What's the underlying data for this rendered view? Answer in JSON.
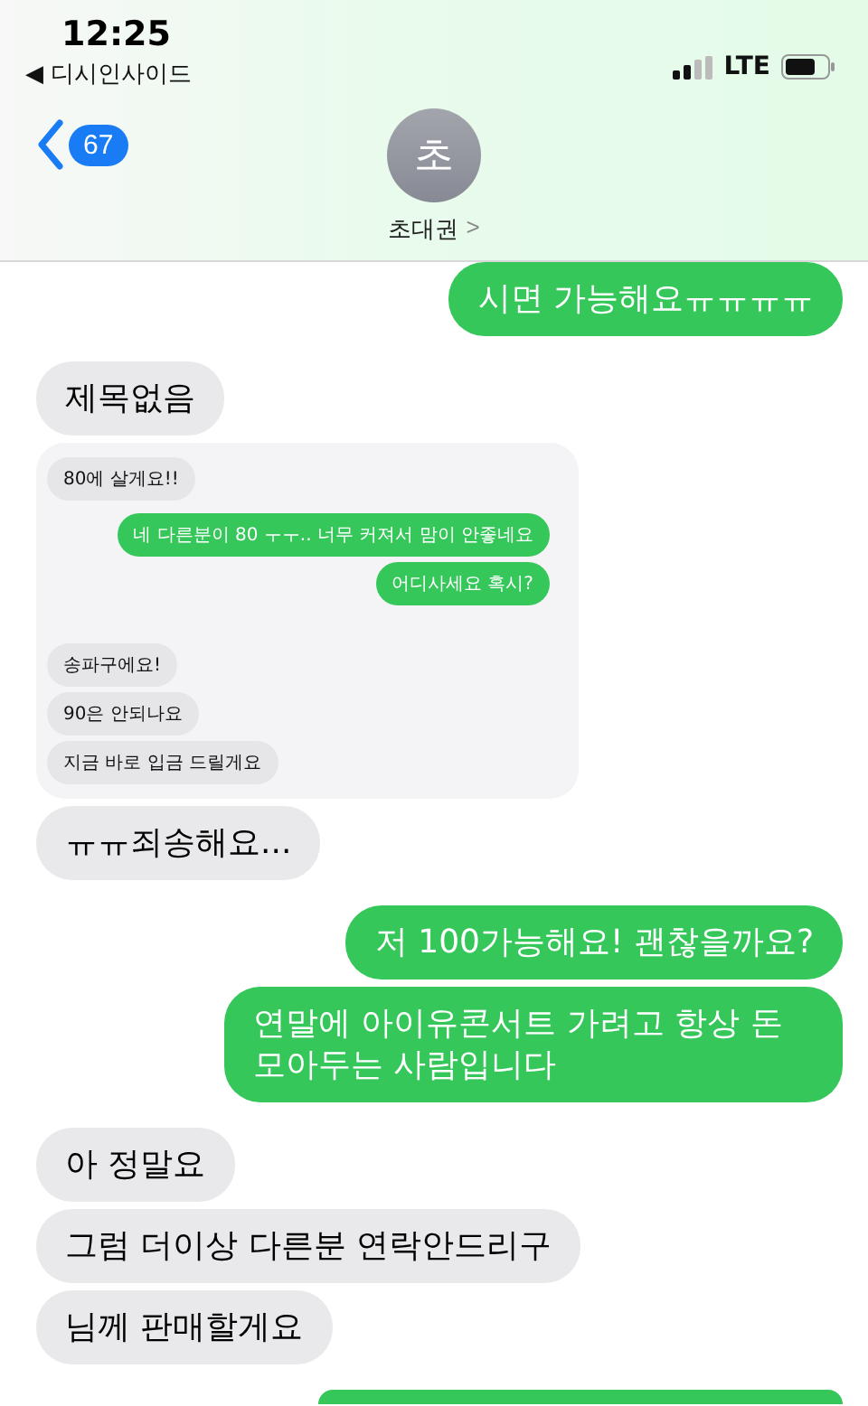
{
  "status_bar": {
    "time": "12:25",
    "back_app": "◀ 디시인사이드",
    "network": "LTE"
  },
  "header": {
    "unread_count": "67",
    "avatar_initial": "초",
    "contact_name": "초대권",
    "name_chevron": ">"
  },
  "messages": [
    {
      "kind": "text",
      "sent": true,
      "text": "시면 가능해요ㅠㅠㅠㅠ"
    },
    {
      "kind": "text",
      "sent": false,
      "text": "제목없음"
    },
    {
      "kind": "screenshot",
      "sent": false,
      "messages": [
        {
          "sent": false,
          "text": "80에 살게요!!"
        },
        {
          "sent": true,
          "text": "네 다른분이 80 ㅜㅜ.. 너무 커져서 맘이 안좋네요"
        },
        {
          "sent": true,
          "text": "어디사세요 혹시?"
        },
        {
          "sent": false,
          "text": "송파구에요!"
        },
        {
          "sent": false,
          "text": "90은 안되나요"
        },
        {
          "sent": false,
          "text": "지금 바로 입금 드릴게요"
        }
      ]
    },
    {
      "kind": "text",
      "sent": false,
      "text": "ㅠㅠ죄송해요..."
    },
    {
      "kind": "text",
      "sent": true,
      "text": "저 100가능해요! 괜찮을까요?"
    },
    {
      "kind": "text",
      "sent": true,
      "text": "연말에 아이유콘서트 가려고 항상 돈 모아두는 사람입니다"
    },
    {
      "kind": "text",
      "sent": false,
      "text": "아 정말요"
    },
    {
      "kind": "text",
      "sent": false,
      "text": "그럼 더이상 다른분 연락안드리구"
    },
    {
      "kind": "text",
      "sent": false,
      "text": "님께 판매할게요"
    },
    {
      "kind": "edge",
      "sent": true
    }
  ]
}
